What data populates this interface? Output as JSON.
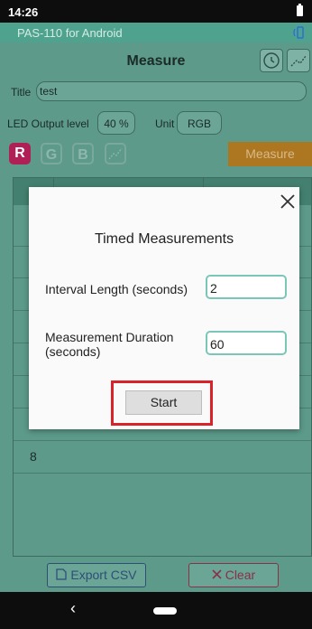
{
  "status_bar": {
    "time": "14:26"
  },
  "app_bar": {
    "app_name": "PAS-110 for Android"
  },
  "header": {
    "title": "Measure"
  },
  "form": {
    "title_label": "Title",
    "title_value": "test",
    "led_label": "LED Output level",
    "led_value": "40 %",
    "unit_label": "Unit",
    "unit_value": "RGB"
  },
  "channels": [
    "R",
    "G",
    "B"
  ],
  "measure_button": "Measure",
  "table": {
    "visible_row_number": "8"
  },
  "footer": {
    "export_label": "Export CSV",
    "clear_label": "Clear"
  },
  "dialog": {
    "title": "Timed Measurements",
    "interval_label": "Interval Length (seconds)",
    "interval_value": "2",
    "duration_label_line1": "Measurement Duration",
    "duration_label_line2": "(seconds)",
    "duration_value": "60",
    "start_label": "Start"
  },
  "colors": {
    "accent_red": "#d9232a",
    "teal": "#7ac7b9",
    "channel_r": "#b01f55",
    "measure_orange": "#ad7620"
  },
  "icons": [
    "battery-icon",
    "bluetooth-icon",
    "timer-icon",
    "graph-icon",
    "close-icon",
    "file-icon",
    "x-icon",
    "back-icon",
    "home-icon"
  ]
}
